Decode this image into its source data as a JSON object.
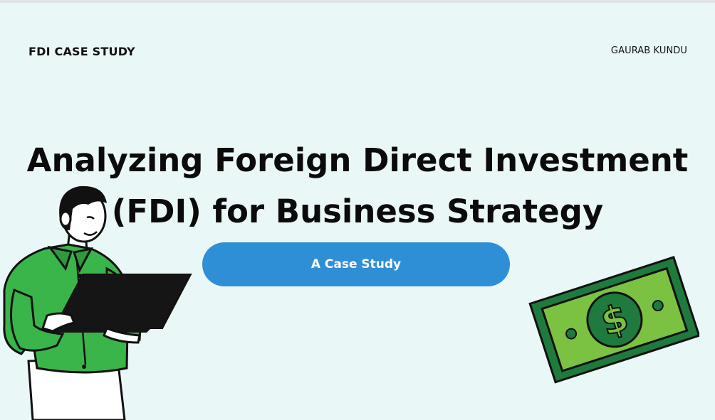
{
  "header": {
    "brand": "FDI CASE STUDY",
    "author": "GAURAB KUNDU"
  },
  "hero": {
    "title_line1": "Analyzing Foreign Direct Investment",
    "title_line2": "(FDI) for Business Strategy",
    "cta_label": "A Case Study"
  },
  "illustrations": {
    "person": "person-with-laptop-illustration",
    "money": "dollar-bill-icon"
  },
  "colors": {
    "background": "#eaf7f7",
    "cta": "#2f8fd6",
    "shirt": "#39b54a",
    "bill": "#7bc142",
    "bill_dark": "#1f7a3e"
  }
}
